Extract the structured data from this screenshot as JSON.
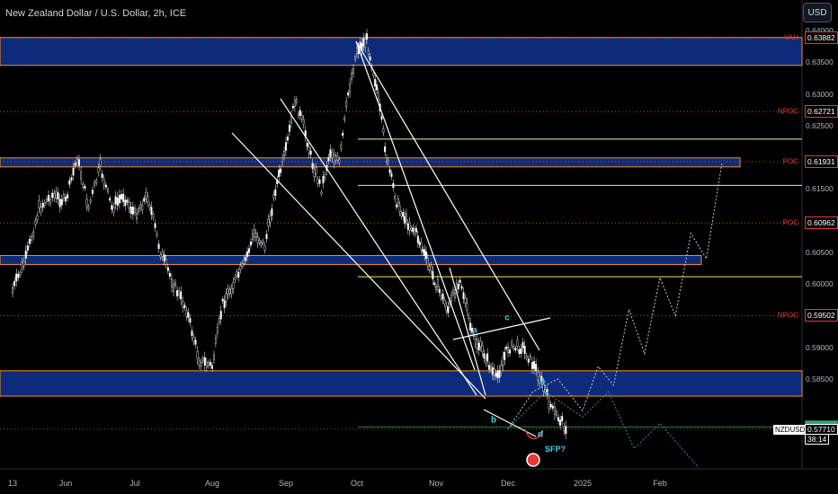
{
  "header": {
    "title": "New Zealand Dollar / U.S. Dollar, 2h, ICE",
    "currency_button": "USD"
  },
  "colors": {
    "zone_fill": "#0d2b7a",
    "zone_border": "#f7931a",
    "candle": "#ffffff",
    "trendline": "#ffffff",
    "projection": "#c8c8c8",
    "alt_projection": "#2a8fa6",
    "level_red": "#e53935",
    "level_yellow": "#f5e663",
    "level_green": "#2e7d32",
    "wave_labels": "#3ad0e6",
    "background": "#000000"
  },
  "chart_data": {
    "type": "candlestick",
    "symbol": "NZDUSD",
    "timeframe": "2h",
    "x_tick_labels": [
      "13",
      "Jun",
      "Jul",
      "Aug",
      "Sep",
      "Oct",
      "Nov",
      "Dec",
      "2025",
      "Feb"
    ],
    "y_tick_labels": [
      "0.64000",
      "0.63500",
      "0.63000",
      "0.62500",
      "0.61500",
      "0.60500",
      "0.60000",
      "0.59000",
      "0.58500"
    ],
    "ylim": [
      0.5675,
      0.64
    ],
    "price_path": [
      [
        "13",
        0.599
      ],
      [
        "13",
        0.604
      ],
      [
        "13",
        0.612
      ],
      [
        "13",
        0.614
      ],
      [
        "Jun",
        0.613
      ],
      [
        "Jun",
        0.62
      ],
      [
        "Jun",
        0.612
      ],
      [
        "Jun",
        0.6185
      ],
      [
        "Jun",
        0.612
      ],
      [
        "Jun",
        0.614
      ],
      [
        "Jul",
        0.611
      ],
      [
        "Jul",
        0.614
      ],
      [
        "Jul",
        0.605
      ],
      [
        "Jul",
        0.6
      ],
      [
        "Jul",
        0.596
      ],
      [
        "Jul",
        0.588
      ],
      [
        "Aug",
        0.587
      ],
      [
        "Aug",
        0.597
      ],
      [
        "Aug",
        0.6
      ],
      [
        "Aug",
        0.603
      ],
      [
        "Aug",
        0.608
      ],
      [
        "Aug",
        0.606
      ],
      [
        "Aug",
        0.615
      ],
      [
        "Sep",
        0.621
      ],
      [
        "Sep",
        0.629
      ],
      [
        "Sep",
        0.625
      ],
      [
        "Sep",
        0.619
      ],
      [
        "Sep",
        0.615
      ],
      [
        "Sep",
        0.621
      ],
      [
        "Sep",
        0.619
      ],
      [
        "Sep",
        0.63
      ],
      [
        "Oct",
        0.637
      ],
      [
        "Oct",
        0.6385
      ],
      [
        "Oct",
        0.631
      ],
      [
        "Oct",
        0.62
      ],
      [
        "Oct",
        0.613
      ],
      [
        "Oct",
        0.61
      ],
      [
        "Oct",
        0.608
      ],
      [
        "Oct",
        0.604
      ],
      [
        "Nov",
        0.6
      ],
      [
        "Nov",
        0.596
      ],
      [
        "Nov",
        0.601
      ],
      [
        "Nov",
        0.592
      ],
      [
        "Nov",
        0.589
      ],
      [
        "Nov",
        0.585
      ],
      [
        "Dec",
        0.59
      ],
      [
        "Dec",
        0.59
      ],
      [
        "Dec",
        0.586
      ],
      [
        "Dec",
        0.58
      ],
      [
        "Dec",
        0.5771
      ]
    ],
    "projection_path": [
      [
        "Dec",
        0.5771
      ],
      [
        "Dec",
        0.583
      ],
      [
        "Dec",
        0.585
      ],
      [
        "2025",
        0.58
      ],
      [
        "2025",
        0.587
      ],
      [
        "2025",
        0.584
      ],
      [
        "2025",
        0.596
      ],
      [
        "2025",
        0.589
      ],
      [
        "Feb",
        0.601
      ],
      [
        "Feb",
        0.595
      ],
      [
        "Feb",
        0.608
      ],
      [
        "Feb",
        0.604
      ],
      [
        "Feb",
        0.619
      ]
    ],
    "alt_projection_path": [
      [
        "Dec",
        0.5771
      ],
      [
        "Dec",
        0.583
      ],
      [
        "2025",
        0.579
      ],
      [
        "2025",
        0.583
      ],
      [
        "2025",
        0.574
      ],
      [
        "Feb",
        0.578
      ],
      [
        "Feb",
        0.571
      ]
    ],
    "zones": [
      {
        "top": 0.6389,
        "bottom": 0.6345
      },
      {
        "top": 0.6199,
        "bottom": 0.6189
      },
      {
        "top": 0.6045,
        "bottom": 0.6035
      },
      {
        "top": 0.5863,
        "bottom": 0.5823
      }
    ],
    "levels": [
      {
        "name": "VAH",
        "price": "0.63882",
        "kind": "red"
      },
      {
        "name": "NPOC",
        "price": "0.62721",
        "kind": "red"
      },
      {
        "name": "POC",
        "price": "0.61931",
        "kind": "red"
      },
      {
        "name": "POC",
        "price": "0.60962",
        "kind": "red"
      },
      {
        "name": "NPOC",
        "price": "0.59502",
        "kind": "red"
      },
      {
        "name": "",
        "price": "0.57743",
        "kind": "green"
      }
    ],
    "white_levels": [
      0.625,
      0.615,
      0.6
    ],
    "wave_labels": [
      "a",
      "b",
      "c",
      "d",
      "e"
    ],
    "annotation": "SFP?",
    "current": {
      "symbol_tag": "NZDUSD",
      "price": "0.57710",
      "countdown": "38:14"
    }
  }
}
